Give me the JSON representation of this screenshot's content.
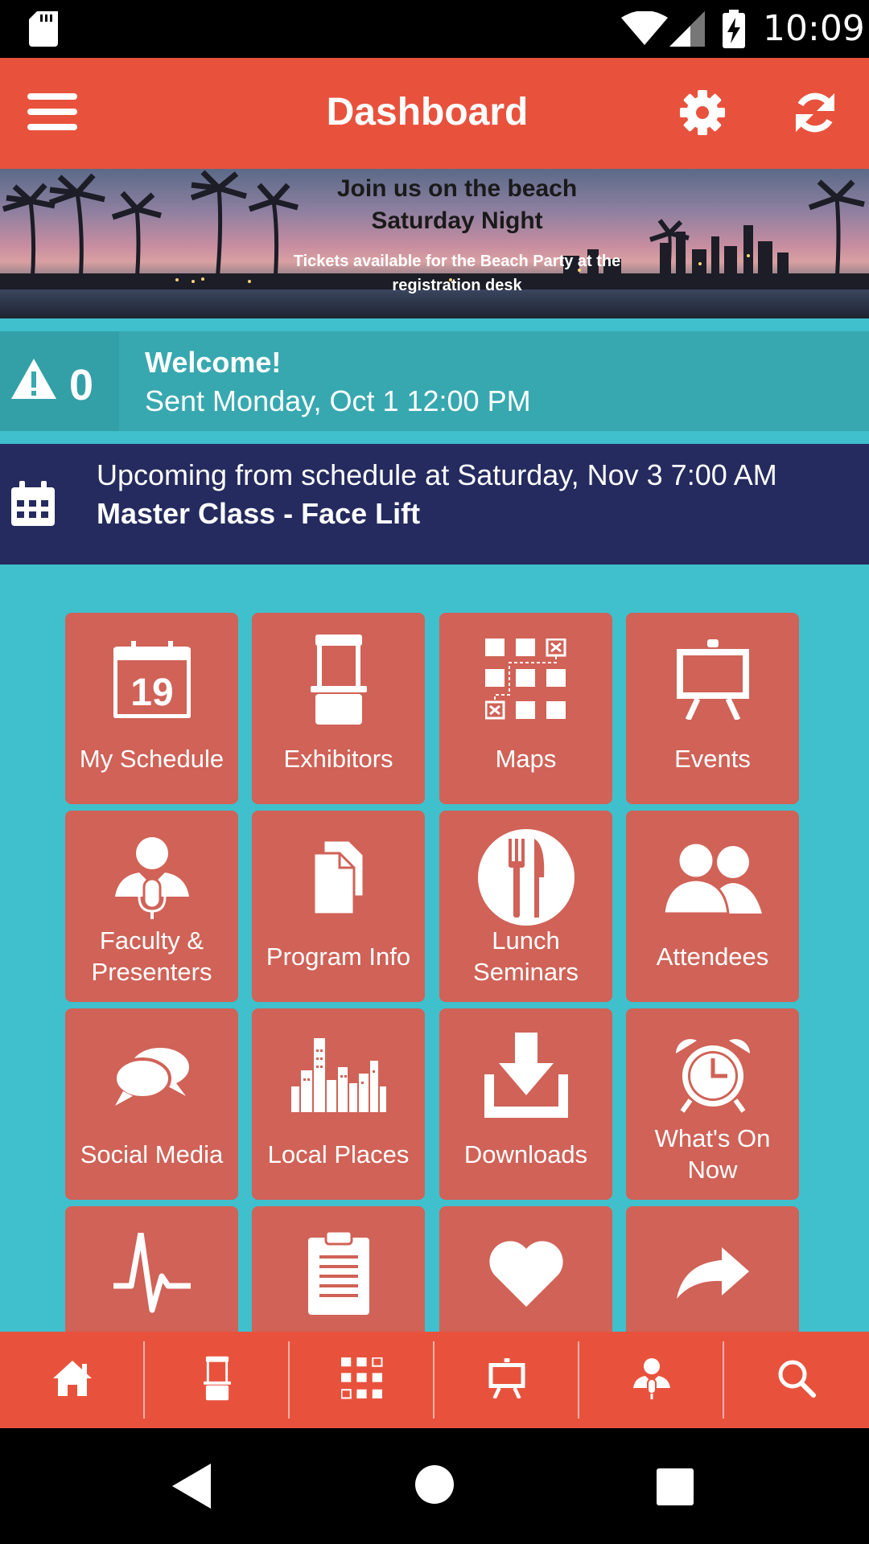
{
  "status_bar": {
    "time": "10:09",
    "icons": [
      "sd-card-icon",
      "wifi-icon",
      "cell-signal-icon",
      "battery-charging-icon"
    ]
  },
  "app_bar": {
    "title": "Dashboard",
    "left_icon": "menu-icon",
    "right_icons": [
      "settings-icon",
      "refresh-icon"
    ]
  },
  "banner": {
    "line1": "Join us on the beach",
    "line2": "Saturday Night",
    "line3": "Tickets available for the Beach Party at the registration desk"
  },
  "message": {
    "count": "0",
    "title": "Welcome!",
    "subtitle": "Sent Monday, Oct 1 12:00 PM"
  },
  "upcoming": {
    "line1": "Upcoming from schedule at Saturday, Nov 3 7:00 AM",
    "line2": "Master Class - Face Lift"
  },
  "tiles": [
    {
      "label": "My Schedule",
      "icon": "calendar-19-icon"
    },
    {
      "label": "Exhibitors",
      "icon": "booth-icon"
    },
    {
      "label": "Maps",
      "icon": "floor-map-icon"
    },
    {
      "label": "Events",
      "icon": "easel-icon"
    },
    {
      "label": "Faculty & Presenters",
      "icon": "presenter-icon"
    },
    {
      "label": "Program Info",
      "icon": "documents-icon"
    },
    {
      "label": "Lunch Seminars",
      "icon": "fork-knife-icon"
    },
    {
      "label": "Attendees",
      "icon": "people-icon"
    },
    {
      "label": "Social Media",
      "icon": "chat-bubbles-icon"
    },
    {
      "label": "Local Places",
      "icon": "city-skyline-icon"
    },
    {
      "label": "Downloads",
      "icon": "download-icon"
    },
    {
      "label": "What's On Now",
      "icon": "alarm-clock-icon"
    },
    {
      "label": "",
      "icon": "pulse-icon"
    },
    {
      "label": "",
      "icon": "clipboard-icon"
    },
    {
      "label": "",
      "icon": "heart-icon"
    },
    {
      "label": "",
      "icon": "share-arrow-icon"
    }
  ],
  "bottom_nav": [
    "home-icon",
    "booth-icon",
    "floor-map-icon",
    "easel-icon",
    "presenter-icon",
    "search-icon"
  ],
  "colors": {
    "app_bar": "#e8523d",
    "tile": "#d06257",
    "background": "#3fc0cc",
    "message_bar": "#38a8b0",
    "upcoming_bar": "#252b5e"
  }
}
